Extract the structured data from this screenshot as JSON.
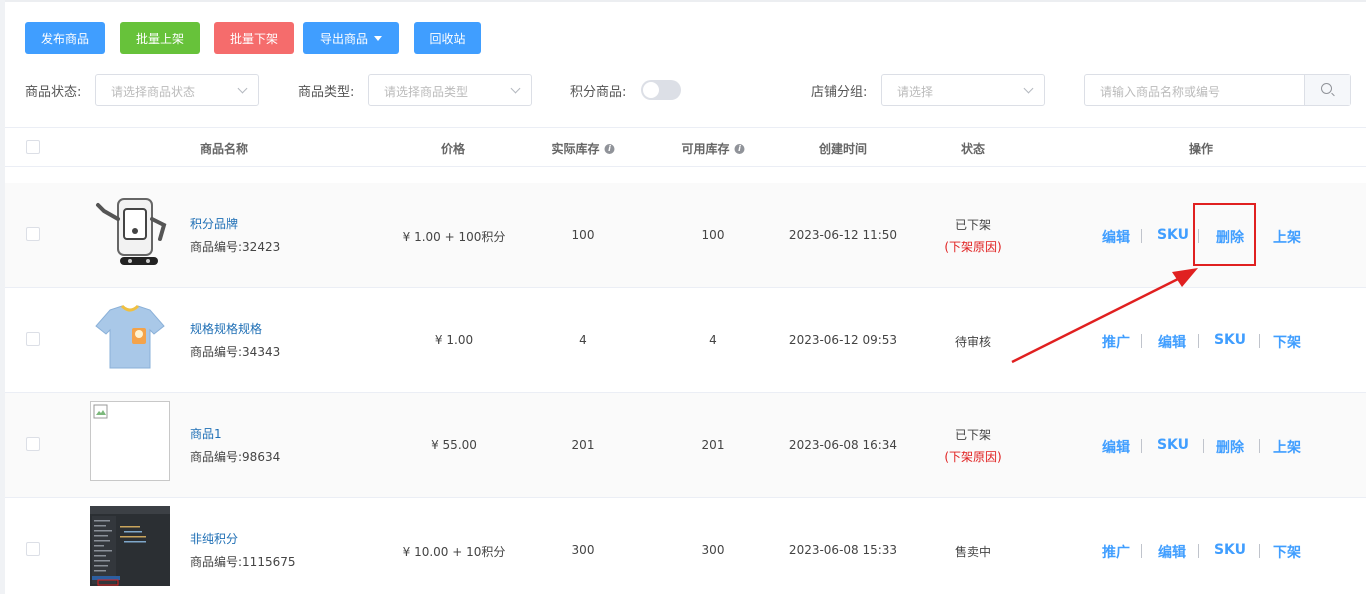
{
  "toolbar": {
    "publish": "发布商品",
    "batch_on": "批量上架",
    "batch_off": "批量下架",
    "export": "导出商品",
    "recycle": "回收站"
  },
  "filters": {
    "status_label": "商品状态:",
    "status_placeholder": "请选择商品状态",
    "type_label": "商品类型:",
    "type_placeholder": "请选择商品类型",
    "points_label": "积分商品:",
    "group_label": "店铺分组:",
    "group_placeholder": "请选择",
    "search_placeholder": "请输入商品名称或编号"
  },
  "table": {
    "headers": {
      "name": "商品名称",
      "price": "价格",
      "actual_stock": "实际库存",
      "available_stock": "可用库存",
      "created": "创建时间",
      "status": "状态",
      "actions": "操作"
    },
    "rows": [
      {
        "name": "积分品牌",
        "code": "商品编号:32423",
        "price": "¥ 1.00 + 100积分",
        "actual_stock": "100",
        "available_stock": "100",
        "created": "2023-06-12 11:50",
        "status": "已下架",
        "reason": "(下架原因)",
        "actions": [
          "编辑",
          "SKU",
          "删除",
          "上架"
        ]
      },
      {
        "name": "规格规格规格",
        "code": "商品编号:34343",
        "price": "¥ 1.00",
        "actual_stock": "4",
        "available_stock": "4",
        "created": "2023-06-12 09:53",
        "status": "待审核",
        "reason": "",
        "actions": [
          "推广",
          "编辑",
          "SKU",
          "下架"
        ]
      },
      {
        "name": "商品1",
        "code": "商品编号:98634",
        "price": "¥ 55.00",
        "actual_stock": "201",
        "available_stock": "201",
        "created": "2023-06-08 16:34",
        "status": "已下架",
        "reason": "(下架原因)",
        "actions": [
          "编辑",
          "SKU",
          "删除",
          "上架"
        ]
      },
      {
        "name": "非纯积分",
        "code": "商品编号:1115675",
        "price": "¥ 10.00 + 10积分",
        "actual_stock": "300",
        "available_stock": "300",
        "created": "2023-06-08 15:33",
        "status": "售卖中",
        "reason": "",
        "actions": [
          "推广",
          "编辑",
          "SKU",
          "下架"
        ]
      }
    ]
  },
  "colors": {
    "primary": "#409eff",
    "success": "#67c23a",
    "danger": "#f56c6c",
    "annotation": "#e02020"
  }
}
